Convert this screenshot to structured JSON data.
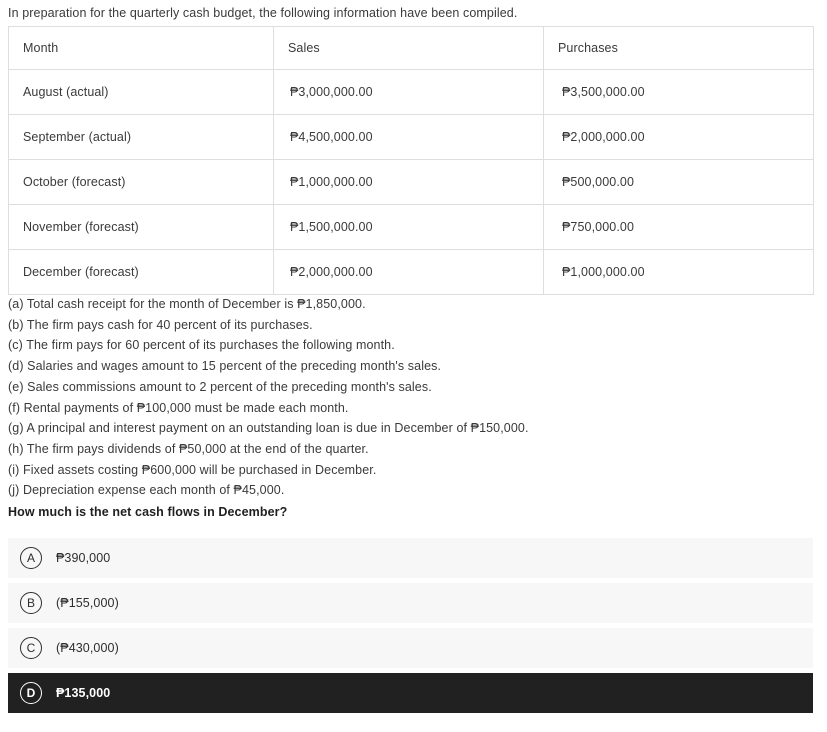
{
  "intro": "In preparation for the quarterly cash budget, the following information have been compiled.",
  "table": {
    "headers": [
      "Month",
      "Sales",
      "Purchases"
    ],
    "rows": [
      {
        "month": "August (actual)",
        "sales": "₱3,000,000.00",
        "purchases": "₱3,500,000.00"
      },
      {
        "month": "September (actual)",
        "sales": "₱4,500,000.00",
        "purchases": "₱2,000,000.00"
      },
      {
        "month": "October (forecast)",
        "sales": "₱1,000,000.00",
        "purchases": "₱500,000.00"
      },
      {
        "month": "November (forecast)",
        "sales": "₱1,500,000.00",
        "purchases": "₱750,000.00"
      },
      {
        "month": "December (forecast)",
        "sales": "₱2,000,000.00",
        "purchases": "₱1,000,000.00"
      }
    ]
  },
  "facts": [
    "(a) Total cash receipt for the month of December is ₱1,850,000.",
    "(b) The firm pays cash for 40 percent of its purchases.",
    "(c) The firm pays for 60 percent of its purchases the following month.",
    "(d) Salaries and wages amount to 15 percent of the preceding month's sales.",
    "(e) Sales commissions amount to 2 percent of the preceding month's sales.",
    "(f) Rental payments of ₱100,000 must be made each month.",
    "(g) A principal and interest payment on an outstanding loan is due in December of ₱150,000.",
    "(h) The firm pays dividends of ₱50,000 at the end of the quarter.",
    "(i) Fixed assets costing ₱600,000 will be purchased in December.",
    "(j) Depreciation expense each month of ₱45,000."
  ],
  "question": "How much is the net cash flows in December?",
  "options": [
    {
      "letter": "A",
      "text": "₱390,000",
      "selected": false
    },
    {
      "letter": "B",
      "text": "(₱155,000)",
      "selected": false
    },
    {
      "letter": "C",
      "text": "(₱430,000)",
      "selected": false
    },
    {
      "letter": "D",
      "text": "₱135,000",
      "selected": true
    }
  ],
  "colors": {
    "selected_background": "#212121",
    "option_background": "#f7f7f7",
    "table_border": "#dedede",
    "text": "#3a3a3a"
  }
}
